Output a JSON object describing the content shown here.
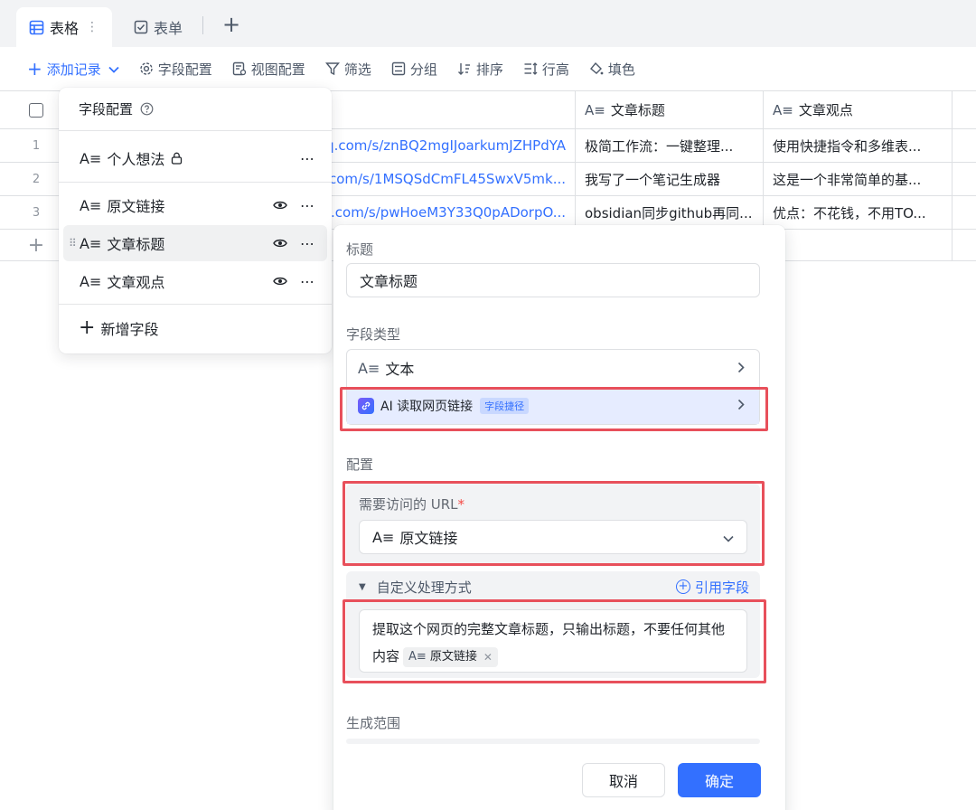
{
  "tabs": [
    {
      "label": "表格",
      "icon": "table-icon",
      "active": true
    },
    {
      "label": "表单",
      "icon": "form-icon",
      "active": false
    }
  ],
  "toolbar": {
    "add_record": "添加记录",
    "field_config": "字段配置",
    "view_config": "视图配置",
    "filter": "筛选",
    "group": "分组",
    "sort": "排序",
    "row_height": "行高",
    "fill_color": "填色"
  },
  "grid": {
    "headers": {
      "title": "文章标题",
      "view": "文章观点"
    },
    "rows": [
      {
        "num": "1",
        "link": "q.com/s/znBQ2mgIJoarkumJZHPdYA",
        "title": "极简工作流：一键整理...",
        "view": "使用快捷指令和多维表..."
      },
      {
        "num": "2",
        "link": "q.com/s/1MSQSdCmFL45SwxV5mk...",
        "title": "我写了一个笔记生成器",
        "view": "这是一个非常简单的基..."
      },
      {
        "num": "3",
        "link": "q.com/s/pwHoeM3Y33Q0pADorpO...",
        "title": "obsidian同步github再同...",
        "view": "优点：不花钱，不用TO..."
      }
    ]
  },
  "field_menu": {
    "title": "字段配置",
    "items": [
      {
        "label": "个人想法",
        "locked": true
      },
      {
        "label": "原文链接",
        "visible": true
      },
      {
        "label": "文章标题",
        "visible": true,
        "highlighted": true
      },
      {
        "label": "文章观点",
        "visible": true
      }
    ],
    "add_field": "新增字段"
  },
  "editor": {
    "title_label": "标题",
    "title_value": "文章标题",
    "type_label": "字段类型",
    "type_text": "文本",
    "ai_type": "AI 读取网页链接",
    "ai_badge": "字段捷径",
    "config_label": "配置",
    "url_label": "需要访问的 URL",
    "url_required": "*",
    "url_value": "原文链接",
    "custom_label": "自定义处理方式",
    "ref_field": "引用字段",
    "prompt_text": "提取这个网页的完整文章标题，只输出标题，不要任何其他内容",
    "prompt_chip": "原文链接",
    "range_label": "生成范围",
    "cancel": "取消",
    "confirm": "确定"
  },
  "colors": {
    "accent": "#3370ff",
    "highlight_frame": "#e8505b",
    "ai_row_bg": "#e6ecff"
  }
}
